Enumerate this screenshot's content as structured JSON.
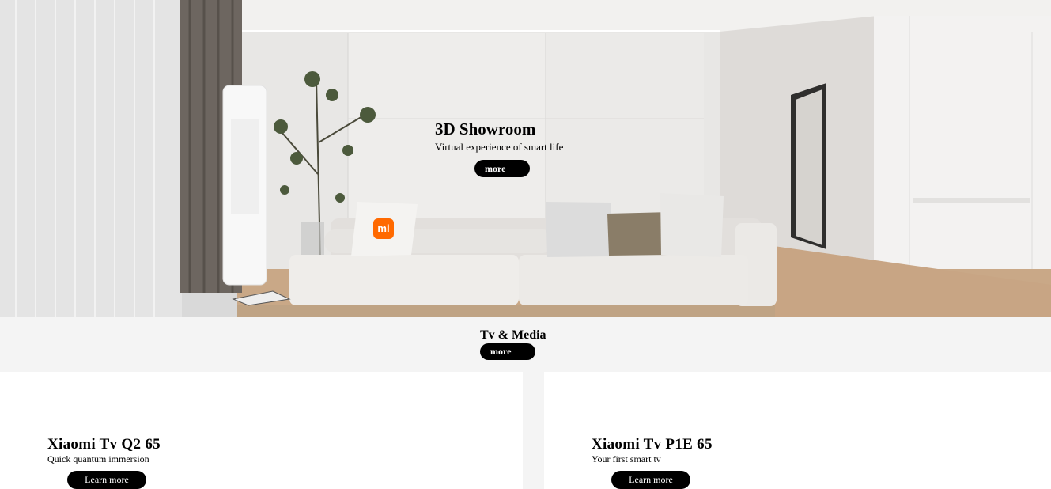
{
  "hero": {
    "title": "3D Showroom",
    "subtitle": "Virtual experience of smart life",
    "button_label": "more",
    "logo_text": "mi"
  },
  "category": {
    "title": "Tv & Media",
    "button_label": "more"
  },
  "products": [
    {
      "name": "Xiaomi Tv Q2 65",
      "tagline": "Quick quantum immersion",
      "button_label": "Learn more"
    },
    {
      "name": "Xiaomi Tv P1E 65",
      "tagline": "Your first smart tv",
      "button_label": "Learn more"
    }
  ],
  "colors": {
    "brand_orange": "#ff6900",
    "button_bg": "#000000",
    "page_bg": "#f4f4f4"
  }
}
